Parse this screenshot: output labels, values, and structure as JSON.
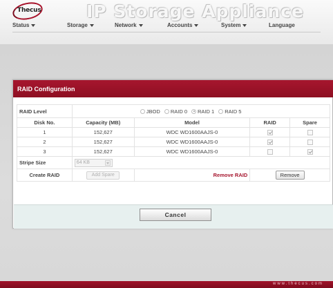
{
  "header": {
    "logo_text": "Thecus",
    "app_title": "IP Storage Appliance"
  },
  "menu": [
    {
      "label": "Status",
      "has_caret": true
    },
    {
      "label": "Storage",
      "has_caret": true
    },
    {
      "label": "Network",
      "has_caret": true
    },
    {
      "label": "Accounts",
      "has_caret": true
    },
    {
      "label": "System",
      "has_caret": true
    },
    {
      "label": "Language",
      "has_caret": false
    }
  ],
  "panel": {
    "title": "RAID Configuration",
    "raid_level_label": "RAID Level",
    "raid_options": [
      {
        "label": "JBOD",
        "selected": false
      },
      {
        "label": "RAID 0",
        "selected": false
      },
      {
        "label": "RAID 1",
        "selected": true
      },
      {
        "label": "RAID 5",
        "selected": false
      }
    ],
    "columns": {
      "disk_no": "Disk No.",
      "capacity": "Capacity (MB)",
      "model": "Model",
      "raid": "RAID",
      "spare": "Spare"
    },
    "disks": [
      {
        "no": "1",
        "capacity": "152,627",
        "model": "WDC WD1600AAJS-0",
        "raid": true,
        "spare": false
      },
      {
        "no": "2",
        "capacity": "152,627",
        "model": "WDC WD1600AAJS-0",
        "raid": true,
        "spare": false
      },
      {
        "no": "3",
        "capacity": "152,627",
        "model": "WDC WD1600AAJS-0",
        "raid": false,
        "spare": true
      }
    ],
    "stripe_size_label": "Stripe Size",
    "stripe_size_value": "64 KB",
    "create_raid_label": "Create RAID",
    "add_spare_button": "Add Spare",
    "remove_raid_label": "Remove RAID",
    "remove_button": "Remove",
    "cancel_button": "Cancel"
  },
  "footer": {
    "url_text": "www.thecus.com"
  },
  "colors": {
    "brand": "#a6162e",
    "footer_bg": "#e7f0ef"
  }
}
